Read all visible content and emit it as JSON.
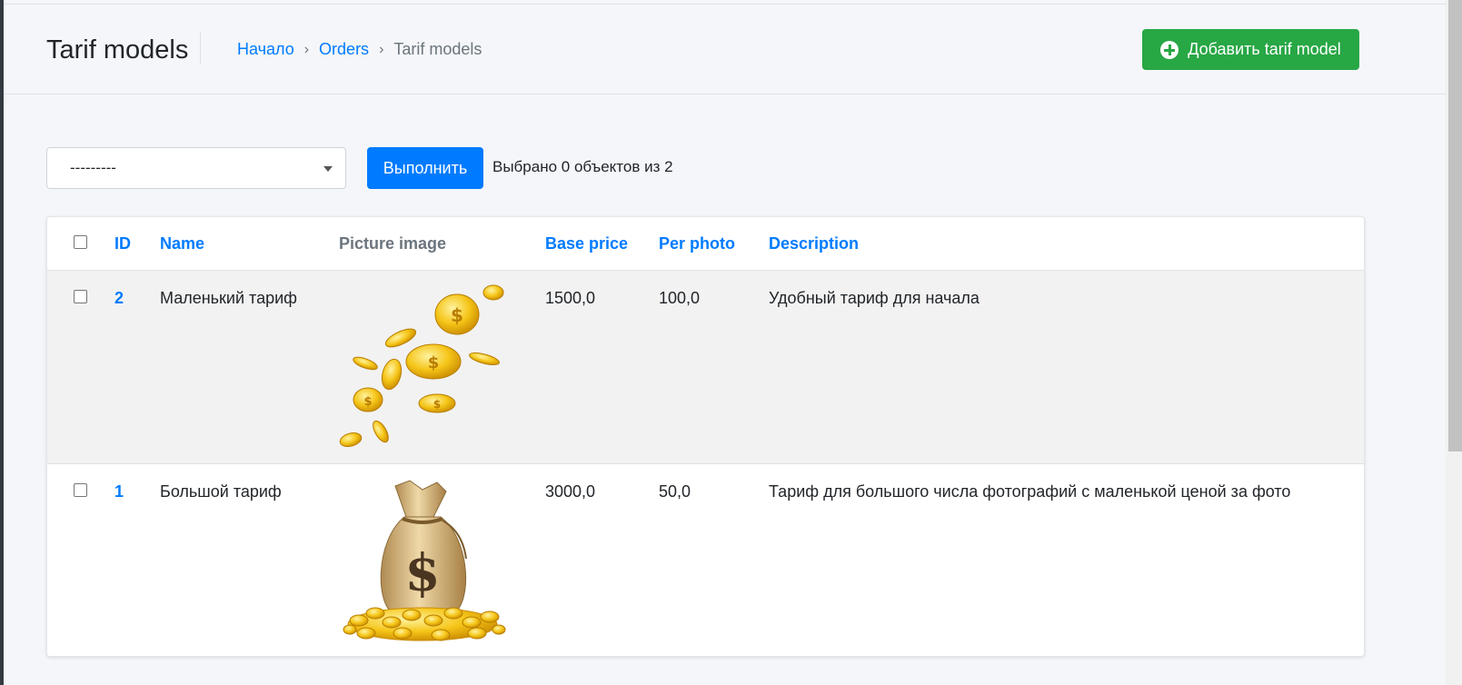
{
  "header": {
    "title": "Tarif models",
    "breadcrumb": [
      {
        "label": "Начало"
      },
      {
        "label": "Orders"
      },
      {
        "label": "Tarif models"
      }
    ],
    "breadcrumb_separator": "›",
    "add_button_label": "Добавить tarif model"
  },
  "actions": {
    "select_value": "---------",
    "run_button_label": "Выполнить",
    "selection_counter": "Выбрано 0 объектов из 2"
  },
  "table": {
    "columns": [
      "ID",
      "Name",
      "Picture image",
      "Base price",
      "Per photo",
      "Description"
    ],
    "rows": [
      {
        "id": "2",
        "name": "Маленький тариф",
        "picture": "coins-image",
        "base_price": "1500,0",
        "per_photo": "100,0",
        "description": "Удобный тариф для начала"
      },
      {
        "id": "1",
        "name": "Большой тариф",
        "picture": "money-bag-image",
        "base_price": "3000,0",
        "per_photo": "50,0",
        "description": "Тариф для большого числа фотографий с маленькой ценой за фото"
      }
    ]
  },
  "colors": {
    "link": "#007bff",
    "success": "#28a745",
    "primary": "#007bff",
    "background": "#f4f6f9"
  }
}
